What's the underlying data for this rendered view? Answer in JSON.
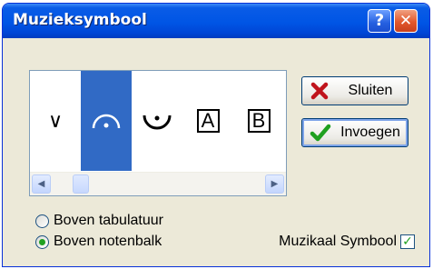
{
  "window": {
    "title": "Muzieksymbool"
  },
  "titlebar": {
    "help_glyph": "?",
    "close_glyph": "✕"
  },
  "symbols": [
    {
      "glyph": "∨",
      "style": "text"
    },
    {
      "glyph": "𝄐",
      "style": "fermata",
      "selected": true
    },
    {
      "glyph": "𝄑",
      "style": "fermata-below"
    },
    {
      "glyph": "A",
      "style": "boxed"
    },
    {
      "glyph": "B",
      "style": "boxed"
    }
  ],
  "scrollbar": {
    "left_arrow": "◀",
    "right_arrow": "▶"
  },
  "buttons": {
    "close_label": "Sluiten",
    "insert_label": "Invoegen"
  },
  "options": {
    "above_tab_label": "Boven tabulatuur",
    "above_staff_label": "Boven notenbalk",
    "selected": "above_staff",
    "musical_symbol_label": "Muzikaal Symbool",
    "musical_symbol_checked": true
  },
  "colors": {
    "titlebar": "#0055e5",
    "selection": "#316ac5",
    "dialog_bg": "#ece9d8"
  }
}
